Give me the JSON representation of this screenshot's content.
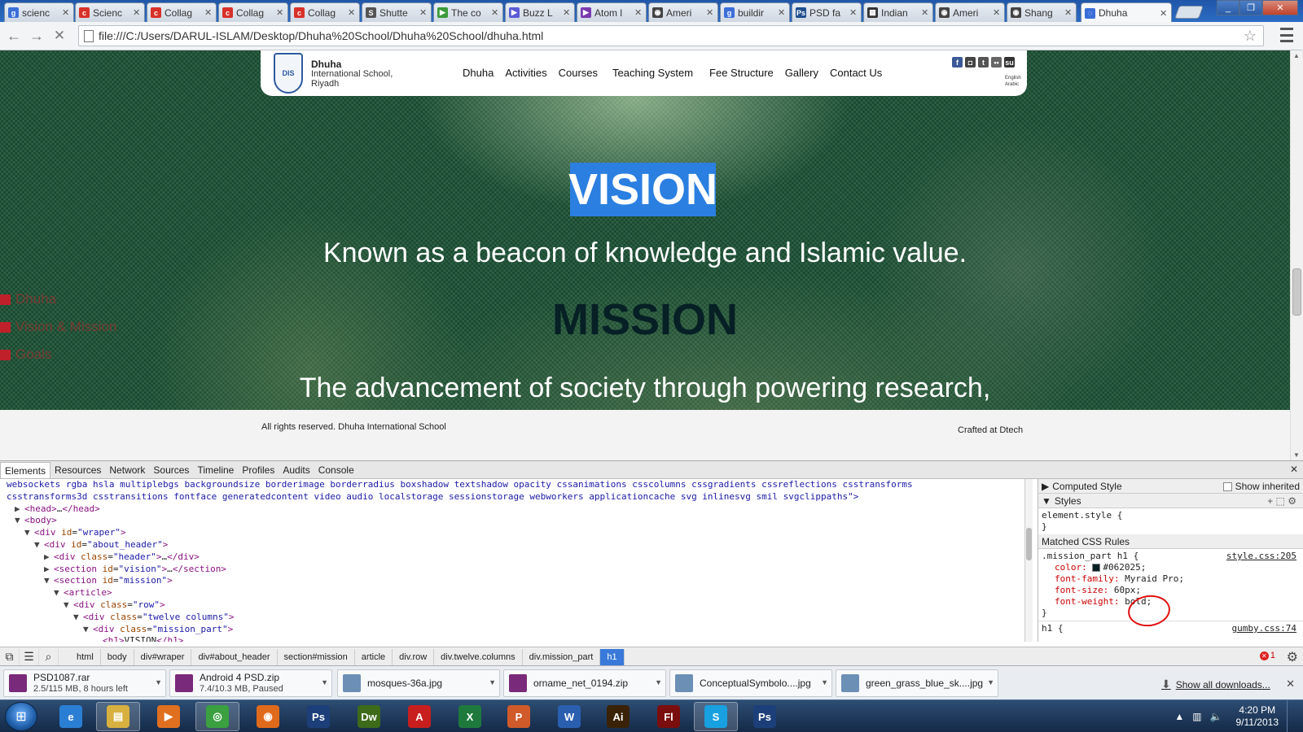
{
  "browser": {
    "tabs": [
      {
        "title": "scienc",
        "icon": "google-icon",
        "color": "#3b6fd8",
        "glyph": "g"
      },
      {
        "title": "Scienc",
        "icon": "collage-icon",
        "color": "#d8312a",
        "glyph": "c"
      },
      {
        "title": "Collag",
        "icon": "collage-icon",
        "color": "#d8312a",
        "glyph": "c"
      },
      {
        "title": "Collag",
        "icon": "collage-icon",
        "color": "#d8312a",
        "glyph": "c"
      },
      {
        "title": "Collag",
        "icon": "collage-icon",
        "color": "#d8312a",
        "glyph": "c"
      },
      {
        "title": "Shutte",
        "icon": "shutterstock-icon",
        "color": "#555555",
        "glyph": "S"
      },
      {
        "title": "The co",
        "icon": "play-icon",
        "color": "#3a9b3a",
        "glyph": "▶"
      },
      {
        "title": "Buzz L",
        "icon": "play-icon",
        "color": "#5b5bd6",
        "glyph": "▶"
      },
      {
        "title": "Atom l",
        "icon": "play-icon",
        "color": "#7a3ab0",
        "glyph": "▶"
      },
      {
        "title": "Ameri",
        "icon": "eye-icon",
        "color": "#444444",
        "glyph": "◉"
      },
      {
        "title": "buildir",
        "icon": "google-icon",
        "color": "#3b6fd8",
        "glyph": "g"
      },
      {
        "title": "PSD fa",
        "icon": "photoshop-icon",
        "color": "#1f4f8f",
        "glyph": "Ps"
      },
      {
        "title": "Indian",
        "icon": "film-icon",
        "color": "#333333",
        "glyph": "▦"
      },
      {
        "title": "Ameri",
        "icon": "eye-icon",
        "color": "#444444",
        "glyph": "◉"
      },
      {
        "title": "Shang",
        "icon": "eye-icon",
        "color": "#444444",
        "glyph": "◉"
      },
      {
        "title": "Dhuha",
        "icon": "loading-icon",
        "color": "#3b6fd8",
        "glyph": "◌"
      }
    ],
    "url": "file:///C:/Users/DARUL-ISLAM/Desktop/Dhuha%20School/Dhuha%20School/dhuha.html"
  },
  "site": {
    "logo_badge": "DIS",
    "logo_name": "Dhuha",
    "logo_line2": "International School,",
    "logo_line3": "Riyadh",
    "nav": [
      "Dhuha",
      "Activities",
      "Courses",
      "Teaching System",
      "Fee Structure",
      "Gallery",
      "Contact Us"
    ],
    "social": [
      {
        "icon": "facebook-icon",
        "color": "#3b5998",
        "glyph": "f"
      },
      {
        "icon": "instagram-icon",
        "color": "#444444",
        "glyph": "◘"
      },
      {
        "icon": "twitter-icon",
        "color": "#555555",
        "glyph": "t"
      },
      {
        "icon": "flickr-icon",
        "color": "#666666",
        "glyph": "••"
      },
      {
        "icon": "stumbleupon-icon",
        "color": "#333333",
        "glyph": "su"
      }
    ],
    "lang_english": "English",
    "lang_arabic": "Arabic",
    "vision_title": "VISION",
    "vision_text": "Known as a beacon of knowledge and Islamic value.",
    "mission_title": "MISSION",
    "mission_text": "The advancement of society through powering research,",
    "side_nav": [
      "Dhuha",
      "Vision & Mission",
      "Goals"
    ],
    "footer_left": "All rights reserved. Dhuha International School",
    "footer_right": "Crafted at Dtech"
  },
  "devtools": {
    "tabs": [
      "Elements",
      "Resources",
      "Network",
      "Sources",
      "Timeline",
      "Profiles",
      "Audits",
      "Console"
    ],
    "dom_line1": "websockets rgba hsla multiplebgs backgroundsize borderimage borderradius boxshadow textshadow opacity cssanimations csscolumns cssgradients cssreflections csstransforms",
    "dom_line2": "csstransforms3d csstransitions fontface generatedcontent video audio localstorage sessionstorage webworkers applicationcache svg inlinesvg smil svgclippaths\">",
    "styles": {
      "computed": "Computed Style",
      "show_inherited": "Show inherited",
      "styles_label": "Styles",
      "element_style": "element.style {",
      "close_brace": "}",
      "matched": "Matched CSS Rules",
      "selector": ".mission_part h1 {",
      "source": "style.css:205",
      "color_prop": "color:",
      "color_val": "#062025;",
      "family_prop": "font-family:",
      "family_val": "Myraid Pro;",
      "size_prop": "font-size:",
      "size_val": "60px;",
      "weight_prop": "font-weight:",
      "weight_val": "bold;",
      "next_selector": "h1 {",
      "next_source": "gumby.css:74"
    },
    "crumbs": [
      "html",
      "body",
      "div#wraper",
      "div#about_header",
      "section#mission",
      "article",
      "div.row",
      "div.twelve.columns",
      "div.mission_part",
      "h1"
    ],
    "error_count": "1"
  },
  "downloads": {
    "items": [
      {
        "name": "PSD1087.rar",
        "status": "2.5/115 MB, 8 hours left",
        "icon": "rar-icon",
        "color": "#7a2a7a"
      },
      {
        "name": "Android 4 PSD.zip",
        "status": "7.4/10.3 MB, Paused",
        "icon": "rar-icon",
        "color": "#7a2a7a"
      },
      {
        "name": "mosques-36a.jpg",
        "status": "",
        "icon": "image-file-icon",
        "color": "#6c8fb5"
      },
      {
        "name": "orname_net_0194.zip",
        "status": "",
        "icon": "rar-icon",
        "color": "#7a2a7a"
      },
      {
        "name": "ConceptualSymbolo....jpg",
        "status": "",
        "icon": "image-file-icon",
        "color": "#6c8fb5"
      },
      {
        "name": "green_grass_blue_sk....jpg",
        "status": "",
        "icon": "image-file-icon",
        "color": "#6c8fb5"
      }
    ],
    "show_all": "Show all downloads..."
  },
  "taskbar": {
    "apps": [
      {
        "name": "ie-icon",
        "glyph": "e",
        "color": "#2a7fd4"
      },
      {
        "name": "explorer-icon",
        "glyph": "▤",
        "color": "#d8b040"
      },
      {
        "name": "media-player-icon",
        "glyph": "▶",
        "color": "#e07020"
      },
      {
        "name": "chrome-icon",
        "glyph": "◎",
        "color": "#3aa040"
      },
      {
        "name": "firefox-icon",
        "glyph": "◉",
        "color": "#e06a1c"
      },
      {
        "name": "photoshop-icon",
        "glyph": "Ps",
        "color": "#1c3f7a"
      },
      {
        "name": "dreamweaver-icon",
        "glyph": "Dw",
        "color": "#3d6b1a"
      },
      {
        "name": "acrobat-icon",
        "glyph": "A",
        "color": "#c81e1e"
      },
      {
        "name": "excel-icon",
        "glyph": "X",
        "color": "#1e7a3c"
      },
      {
        "name": "presentation-icon",
        "glyph": "P",
        "color": "#d05a2a"
      },
      {
        "name": "word-icon",
        "glyph": "W",
        "color": "#2a5fb0"
      },
      {
        "name": "illustrator-icon",
        "glyph": "Ai",
        "color": "#3a2208"
      },
      {
        "name": "flash-icon",
        "glyph": "Fl",
        "color": "#7a0e0e"
      },
      {
        "name": "skype-icon",
        "glyph": "S",
        "color": "#18a0e0"
      },
      {
        "name": "photoshop-icon",
        "glyph": "Ps",
        "color": "#1c3f7a"
      }
    ],
    "time": "4:20 PM",
    "date": "9/11/2013"
  }
}
